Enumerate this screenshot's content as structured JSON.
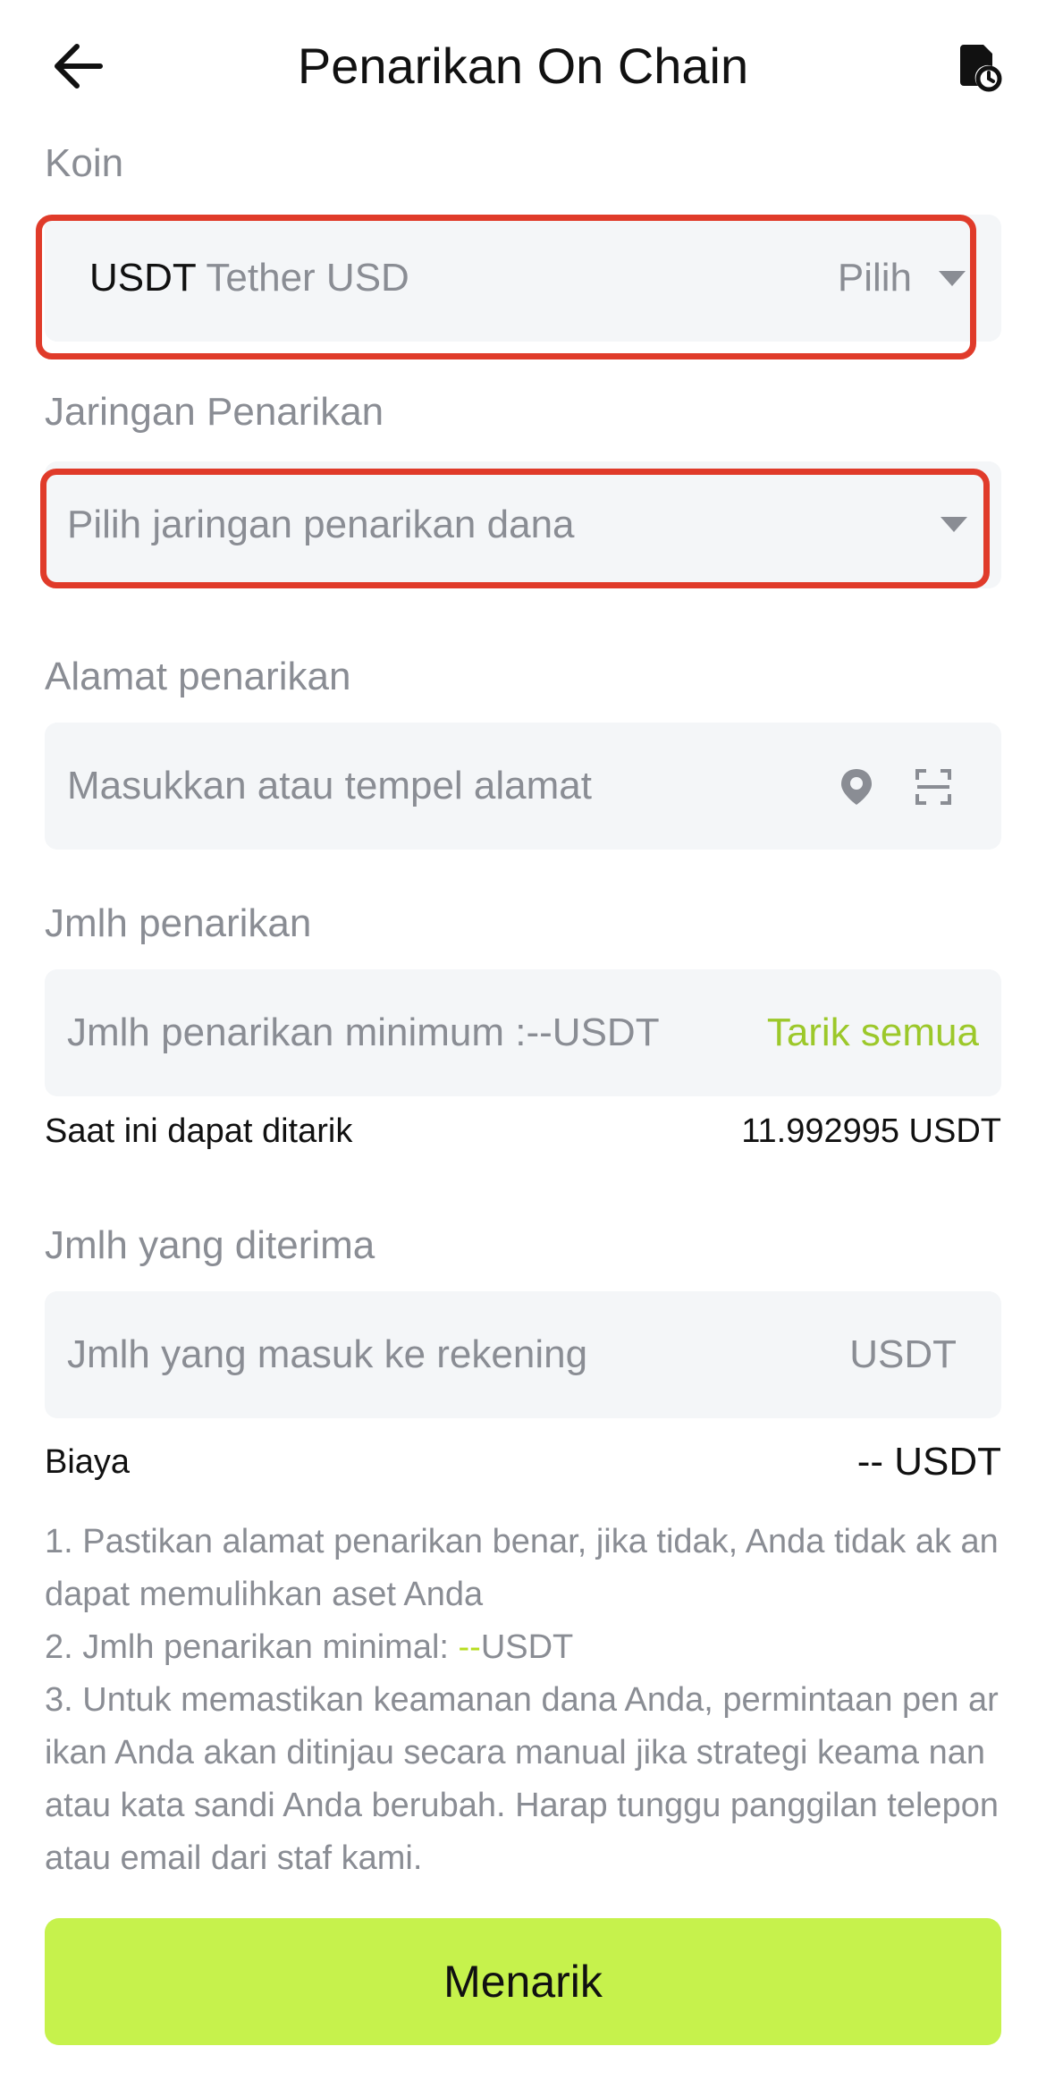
{
  "header": {
    "title": "Penarikan On Chain",
    "back_icon": "arrow-left-icon",
    "history_icon": "history-record-icon"
  },
  "coin": {
    "label": "Koin",
    "symbol": "USDT",
    "name": "Tether USD",
    "select_label": "Pilih"
  },
  "network": {
    "label": "Jaringan Penarikan",
    "placeholder": "Pilih jaringan penarikan dana"
  },
  "address": {
    "label": "Alamat penarikan",
    "placeholder": "Masukkan atau tempel alamat",
    "location_icon": "location-pin-icon",
    "scan_icon": "scan-icon"
  },
  "amount": {
    "label": "Jmlh penarikan",
    "placeholder": "Jmlh penarikan minimum :--USDT",
    "withdraw_all": "Tarik semua",
    "available_label": "Saat ini dapat ditarik",
    "available_value": "11.992995 USDT"
  },
  "received": {
    "label": "Jmlh yang diterima",
    "placeholder": "Jmlh yang masuk ke rekening",
    "unit": "USDT"
  },
  "fee": {
    "label": "Biaya",
    "value": "-- USDT"
  },
  "notes": {
    "n1": "1. Pastikan alamat penarikan benar, jika tidak, Anda tidak ak an dapat memulihkan aset Anda",
    "n2_prefix": "2. Jmlh penarikan minimal: ",
    "n2_value": "--",
    "n2_suffix": "USDT",
    "n3": "3. Untuk memastikan keamanan dana Anda, permintaan pen arikan Anda akan ditinjau secara manual jika strategi keama nan atau kata sandi Anda berubah. Harap tunggu panggilan telepon atau email dari staf kami."
  },
  "submit_label": "Menarik",
  "colors": {
    "accent": "#c6f24c",
    "accent_text": "#9cc82a",
    "highlight": "#e03b2a",
    "field_bg": "#f4f6f8",
    "muted": "#8a8d94"
  }
}
